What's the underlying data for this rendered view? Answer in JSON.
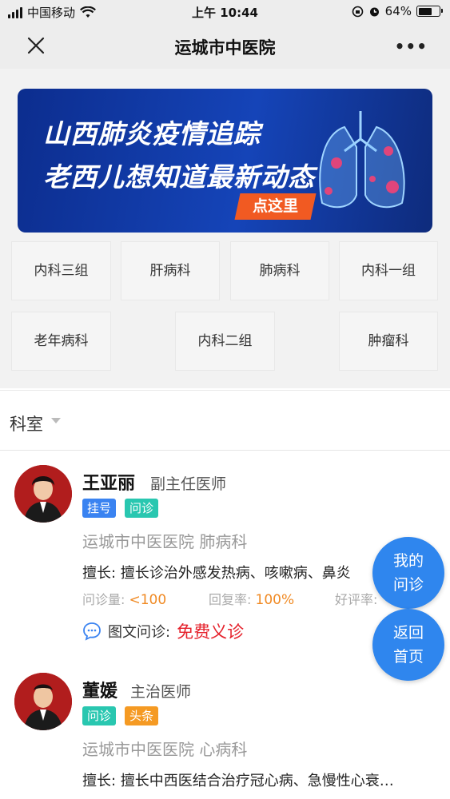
{
  "status": {
    "carrier": "中国移动",
    "time": "上午 10:44",
    "battery": "64%",
    "battery_level": 0.64
  },
  "nav": {
    "title": "运城市中医院",
    "more": "•••"
  },
  "banner": {
    "line1": "山西肺炎疫情追踪",
    "line2": "老西儿想知道最新动态",
    "cta": "点这里"
  },
  "departments": [
    "内科三组",
    "肝病科",
    "肺病科",
    "内科一组",
    "老年病科",
    "内科二组",
    "肿瘤科"
  ],
  "filter": {
    "label": "科室"
  },
  "doctors": [
    {
      "name": "王亚丽",
      "title": "副主任医师",
      "tags": [
        "挂号",
        "问诊"
      ],
      "hospital": "运城市中医医院 肺病科",
      "specialty": "擅长: 擅长诊治外感发热病、咳嗽病、鼻炎",
      "stats": {
        "consult_label": "问诊量:",
        "consult_value": "<100",
        "reply_label": "回复率:",
        "reply_value": "100%",
        "rating_label": "好评率:"
      },
      "consult_type": "图文问诊:",
      "consult_price": "免费义诊"
    },
    {
      "name": "董媛",
      "title": "主治医师",
      "tags": [
        "问诊",
        "头条"
      ],
      "hospital": "运城市中医医院 心病科",
      "specialty": "擅长: 擅长中西医结合治疗冠心病、急慢性心衰…"
    }
  ],
  "fab": {
    "my_consult": [
      "我的",
      "问诊"
    ],
    "home": [
      "返回",
      "首页"
    ]
  },
  "colors": {
    "accent": "#2f86ee",
    "orange": "#f08a24",
    "red": "#e5212b",
    "banner": "#1544b8"
  }
}
